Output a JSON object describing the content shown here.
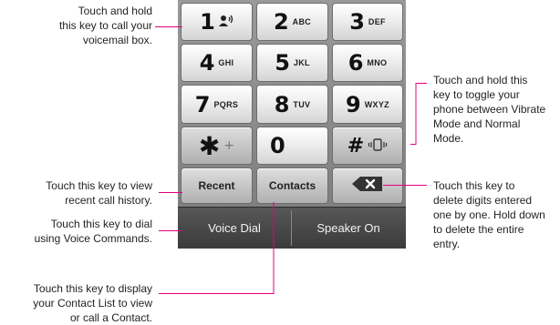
{
  "colors": {
    "leader": "#e4007f",
    "panel": "#8a8a8a",
    "bottom_bar": "#474747"
  },
  "keys": [
    {
      "name": "key-1",
      "digit": "1",
      "sub": "",
      "icon": "voicemail-icon",
      "glyph": "⚉"
    },
    {
      "name": "key-2",
      "digit": "2",
      "sub": "ABC"
    },
    {
      "name": "key-3",
      "digit": "3",
      "sub": "DEF"
    },
    {
      "name": "key-4",
      "digit": "4",
      "sub": "GHI"
    },
    {
      "name": "key-5",
      "digit": "5",
      "sub": "JKL"
    },
    {
      "name": "key-6",
      "digit": "6",
      "sub": "MNO"
    },
    {
      "name": "key-7",
      "digit": "7",
      "sub": "PQRS"
    },
    {
      "name": "key-8",
      "digit": "8",
      "sub": "TUV"
    },
    {
      "name": "key-9",
      "digit": "9",
      "sub": "WXYZ"
    },
    {
      "name": "key-star",
      "digit": "✱",
      "sub": "+"
    },
    {
      "name": "key-0",
      "digit": "0",
      "sub": ""
    },
    {
      "name": "key-hash",
      "digit": "#",
      "sub": "",
      "icon": "vibrate-icon",
      "glyph": "≡"
    }
  ],
  "function_keys": {
    "recent": "Recent",
    "contacts": "Contacts",
    "backspace_icon": "backspace-icon"
  },
  "soft_buttons": {
    "voice_dial": "Voice Dial",
    "speaker_on": "Speaker On"
  },
  "callouts": {
    "voicemail": [
      "Touch and hold",
      "this key to call your",
      "voicemail box."
    ],
    "vibrate": [
      "Touch and hold this",
      "key to toggle your",
      "phone between Vibrate",
      "Mode and Normal",
      "Mode."
    ],
    "recent": [
      "Touch this key to view",
      "recent call history."
    ],
    "voice_dial": [
      "Touch this key to dial",
      "using Voice Commands."
    ],
    "backspace": [
      "Touch this key to",
      "delete digits entered",
      "one by one. Hold down",
      "to delete the entire",
      "entry."
    ],
    "contacts": [
      "Touch this key to display",
      "your Contact List to view",
      "or call a Contact."
    ]
  }
}
